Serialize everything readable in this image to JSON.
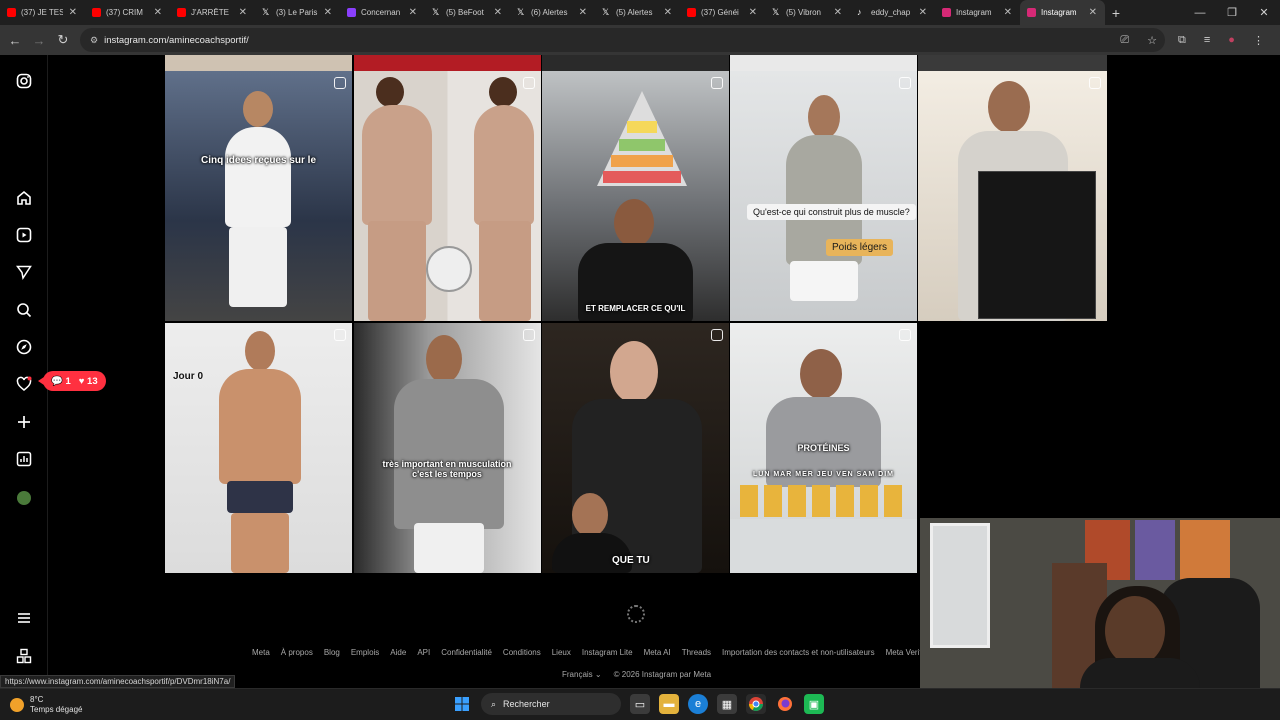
{
  "browser": {
    "tabs": [
      {
        "label": "(37) JE TES",
        "color": "#ff0000"
      },
      {
        "label": "(37) CRIM",
        "color": "#ff0000"
      },
      {
        "label": "J'ARRÊTE",
        "color": "#ff0000"
      },
      {
        "label": "(3) Le Paris",
        "color": "#ffffff"
      },
      {
        "label": "Concernan",
        "color": "#8a3ffc"
      },
      {
        "label": "(5) BeFoot",
        "color": "#ffffff"
      },
      {
        "label": "(6) Alertes",
        "color": "#ffffff"
      },
      {
        "label": "(5) Alertes",
        "color": "#ffffff"
      },
      {
        "label": "(37) Généi",
        "color": "#ff0000"
      },
      {
        "label": "(5) Vibron",
        "color": "#ffffff"
      },
      {
        "label": "eddy_chap",
        "color": "#111111"
      },
      {
        "label": "Instagram",
        "color": "#d62976"
      },
      {
        "label": "Instagram",
        "color": "#d62976",
        "active": true
      }
    ],
    "new_tab": "+",
    "url": "instagram.com/aminecoachsportif/",
    "status_url": "https://www.instagram.com/aminecoachsportif/p/DVDmr18iN7a/"
  },
  "sidebar": {
    "icons": [
      "instagram-logo-icon",
      "home-icon",
      "reels-icon",
      "messages-icon",
      "search-icon",
      "explore-icon",
      "notifications-heart-icon",
      "create-icon",
      "dashboard-icon",
      "profile-avatar",
      "menu-icon",
      "threads-icon"
    ],
    "notifications": {
      "comments": "1",
      "likes": "13"
    }
  },
  "posts": [
    {
      "caption": "Cinq idees reçues sur le"
    },
    {
      "caption": ""
    },
    {
      "caption": "ET REMPLACER CE QU'IL"
    },
    {
      "caption": "Qu'est-ce qui construit plus de muscle?",
      "caption2": "Poids légers"
    },
    {
      "caption": ""
    },
    {
      "caption": "Jour 0"
    },
    {
      "caption": "très important en musculation c'est les tempos"
    },
    {
      "caption": "QUE TU"
    },
    {
      "caption": "PROTÉINES",
      "days": "LUN MAR MER JEU VEN SAM DIM"
    }
  ],
  "footer": {
    "links": [
      "Meta",
      "À propos",
      "Blog",
      "Emplois",
      "Aide",
      "API",
      "Confidentialité",
      "Conditions",
      "Lieux",
      "Instagram Lite",
      "Meta AI",
      "Threads",
      "Importation des contacts et non-utilisateurs",
      "Meta Verifi"
    ],
    "language": "Français",
    "copyright": "© 2026 Instagram par Meta"
  },
  "taskbar": {
    "temperature": "8°C",
    "weather": "Temps dégagé",
    "search_placeholder": "Rechercher"
  }
}
